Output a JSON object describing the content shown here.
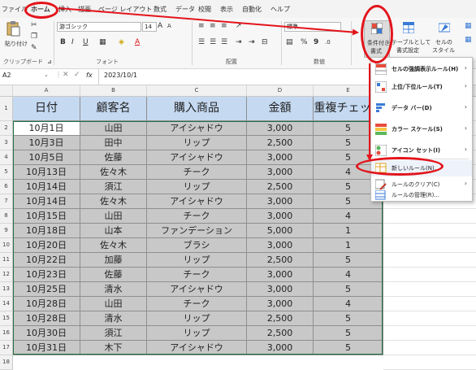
{
  "menubar": {
    "tabs": [
      "ファイル",
      "ホーム",
      "挿入",
      "描画",
      "ページ レイアウト",
      "数式",
      "データ",
      "校閲",
      "表示",
      "自動化",
      "ヘルプ"
    ]
  },
  "ribbon": {
    "clipboard": {
      "paste_label": "貼り付け",
      "group_label": "クリップボード"
    },
    "font": {
      "font_name": "游ゴシック",
      "font_size": "14",
      "group_label": "フォント",
      "bold": "B",
      "italic": "I",
      "underline": "U"
    },
    "alignment": {
      "group_label": "配置"
    },
    "number": {
      "format": "標準",
      "percent": "%",
      "comma": "9",
      "group_label": "数値"
    },
    "styles": {
      "conditional_format_label1": "条件付き",
      "conditional_format_label2": "書式",
      "table_label1": "テーブルとして",
      "table_label2": "書式設定",
      "cell_style_label1": "セルの",
      "cell_style_label2": "スタイル"
    }
  },
  "formula_bar": {
    "name_box": "A2",
    "fx": "fx",
    "value": "2023/10/1"
  },
  "columns": [
    "A",
    "B",
    "C",
    "D",
    "E"
  ],
  "rows": [
    "1",
    "2",
    "3",
    "4",
    "5",
    "6",
    "7",
    "8",
    "9",
    "10",
    "11",
    "12",
    "13",
    "14",
    "15",
    "16",
    "17",
    "18"
  ],
  "table": {
    "headers": [
      "日付",
      "顧客名",
      "購入商品",
      "金額",
      "重複チェック"
    ],
    "rows": [
      [
        "10月1日",
        "山田",
        "アイシャドウ",
        "3,000",
        "5"
      ],
      [
        "10月3日",
        "田中",
        "リップ",
        "2,500",
        "5"
      ],
      [
        "10月5日",
        "佐藤",
        "アイシャドウ",
        "3,000",
        "5"
      ],
      [
        "10月13日",
        "佐々木",
        "チーク",
        "3,000",
        "4"
      ],
      [
        "10月14日",
        "須江",
        "リップ",
        "2,500",
        "5"
      ],
      [
        "10月14日",
        "佐々木",
        "アイシャドウ",
        "3,000",
        "5"
      ],
      [
        "10月15日",
        "山田",
        "チーク",
        "3,000",
        "4"
      ],
      [
        "10月18日",
        "山本",
        "ファンデーション",
        "5,000",
        "1"
      ],
      [
        "10月20日",
        "佐々木",
        "ブラシ",
        "3,000",
        "1"
      ],
      [
        "10月22日",
        "加藤",
        "リップ",
        "2,500",
        "5"
      ],
      [
        "10月23日",
        "佐藤",
        "チーク",
        "3,000",
        "4"
      ],
      [
        "10月25日",
        "清水",
        "アイシャドウ",
        "3,000",
        "5"
      ],
      [
        "10月28日",
        "山田",
        "チーク",
        "3,000",
        "4"
      ],
      [
        "10月28日",
        "清水",
        "リップ",
        "2,500",
        "5"
      ],
      [
        "10月30日",
        "須江",
        "リップ",
        "2,500",
        "5"
      ],
      [
        "10月31日",
        "木下",
        "アイシャドウ",
        "3,000",
        "5"
      ]
    ]
  },
  "cf_menu": {
    "items": [
      {
        "label": "セルの強調表示ルール(H)",
        "arrow": "›"
      },
      {
        "label": "上位/下位ルール(T)",
        "arrow": "›"
      },
      {
        "label": "データ バー(D)",
        "arrow": "›"
      },
      {
        "label": "カラー スケール(S)",
        "arrow": "›"
      },
      {
        "label": "アイコン セット(I)",
        "arrow": "›"
      },
      {
        "label": "新しいルール(N)..."
      },
      {
        "label": "ルールのクリア(C)",
        "arrow": "›"
      },
      {
        "label": "ルールの管理(R)..."
      }
    ]
  },
  "colors": {
    "accent_red": "#e3141b",
    "header_blue": "#c5d9f1",
    "selected_gray": "#c8c8c8",
    "excel_green": "#217346"
  }
}
